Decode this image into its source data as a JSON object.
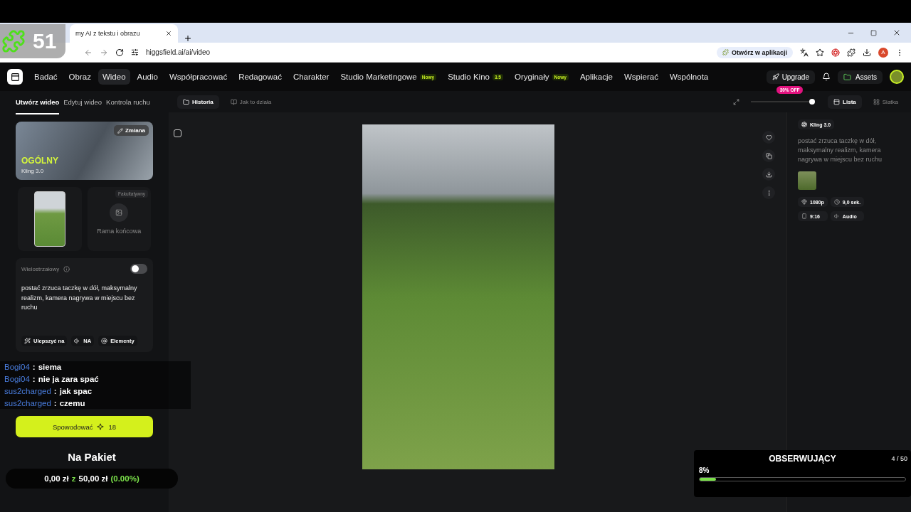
{
  "stream_overlay": {
    "badge": "51"
  },
  "browser": {
    "tab_title": "my AI z tekstu i obrazu",
    "url": "higgsfield.ai/ai/video",
    "open_in_app": "Otwórz w aplikacji",
    "profile_initial": "A"
  },
  "nav": {
    "items": [
      {
        "label": "Badać",
        "selected": false
      },
      {
        "label": "Obraz",
        "selected": false
      },
      {
        "label": "Wideo",
        "selected": true
      },
      {
        "label": "Audio",
        "selected": false
      },
      {
        "label": "Współpracować",
        "selected": false
      },
      {
        "label": "Redagować",
        "selected": false
      },
      {
        "label": "Charakter",
        "selected": false
      },
      {
        "label": "Studio Marketingowe",
        "selected": false,
        "badge": "Nowy"
      },
      {
        "label": "Studio Kino",
        "selected": false,
        "badge": "3.5"
      },
      {
        "label": "Oryginały",
        "selected": false,
        "badge": "Nowy"
      },
      {
        "label": "Aplikacje",
        "selected": false
      },
      {
        "label": "Wspierać",
        "selected": false
      },
      {
        "label": "Wspólnota",
        "selected": false
      }
    ],
    "upgrade": "Upgrade",
    "discount": "30% OFF",
    "assets": "Assets"
  },
  "left_panel": {
    "tabs": [
      {
        "label": "Utwórz wideo",
        "selected": true
      },
      {
        "label": "Edytuj wideo",
        "selected": false
      },
      {
        "label": "Kontrola ruchu",
        "selected": false
      }
    ],
    "model": {
      "category": "OGÓLNY",
      "name": "Kling 3.0",
      "change": "Zmiana"
    },
    "end_frame": {
      "badge": "Fakultatywny",
      "label": "Rama końcowa"
    },
    "multishot": {
      "label": "Wielostrzałowy",
      "on": false
    },
    "prompt": "postać zrzuca taczkę w dół, maksymalny realizm, kamera nagrywa w miejscu bez ruchu",
    "prompt_tools": [
      {
        "kind": "enhance",
        "label": "Ulepszyć na"
      },
      {
        "kind": "audio",
        "label": "NA"
      },
      {
        "kind": "elements",
        "label": "Elementy"
      }
    ],
    "generate": {
      "label": "Spowodować",
      "cost": "18"
    }
  },
  "toolbar": {
    "tabs": [
      {
        "label": "Historia",
        "selected": true
      },
      {
        "label": "Jak to działa",
        "selected": false
      }
    ],
    "zoom": {
      "level": 0.95
    },
    "video_selected": false,
    "views": [
      {
        "label": "Lista",
        "selected": true
      },
      {
        "label": "Siatka",
        "selected": false
      }
    ]
  },
  "details": {
    "model": "Kling 3.0",
    "prompt": "postać zrzuca taczkę w dół, maksymalny realizm, kamera nagrywa w miejscu bez ruchu",
    "tags": [
      {
        "kind": "resolution",
        "label": "1080p"
      },
      {
        "kind": "duration",
        "label": "9,0 sek."
      },
      {
        "kind": "ratio",
        "label": "9:16"
      },
      {
        "kind": "audio",
        "label": "Audio"
      }
    ]
  },
  "chat": [
    {
      "user": "Bogi04",
      "separator": ":",
      "message": "siema"
    },
    {
      "user": "Bogi04",
      "separator": ":",
      "message": "nie ja zara spać"
    },
    {
      "user": "sus2charged",
      "separator": ":",
      "message": "jak spac"
    },
    {
      "user": "sus2charged",
      "separator": ":",
      "message": "czemu"
    }
  ],
  "donation_goal": {
    "title": "Na Pakiet",
    "current": "0,00 zł",
    "separator": "z",
    "target": "50,00 zł",
    "percent": "(0.00%)"
  },
  "followers_goal": {
    "title": "OBSERWUJĄCY",
    "count": "4 / 50",
    "percent": "8%",
    "level": 0.08
  }
}
